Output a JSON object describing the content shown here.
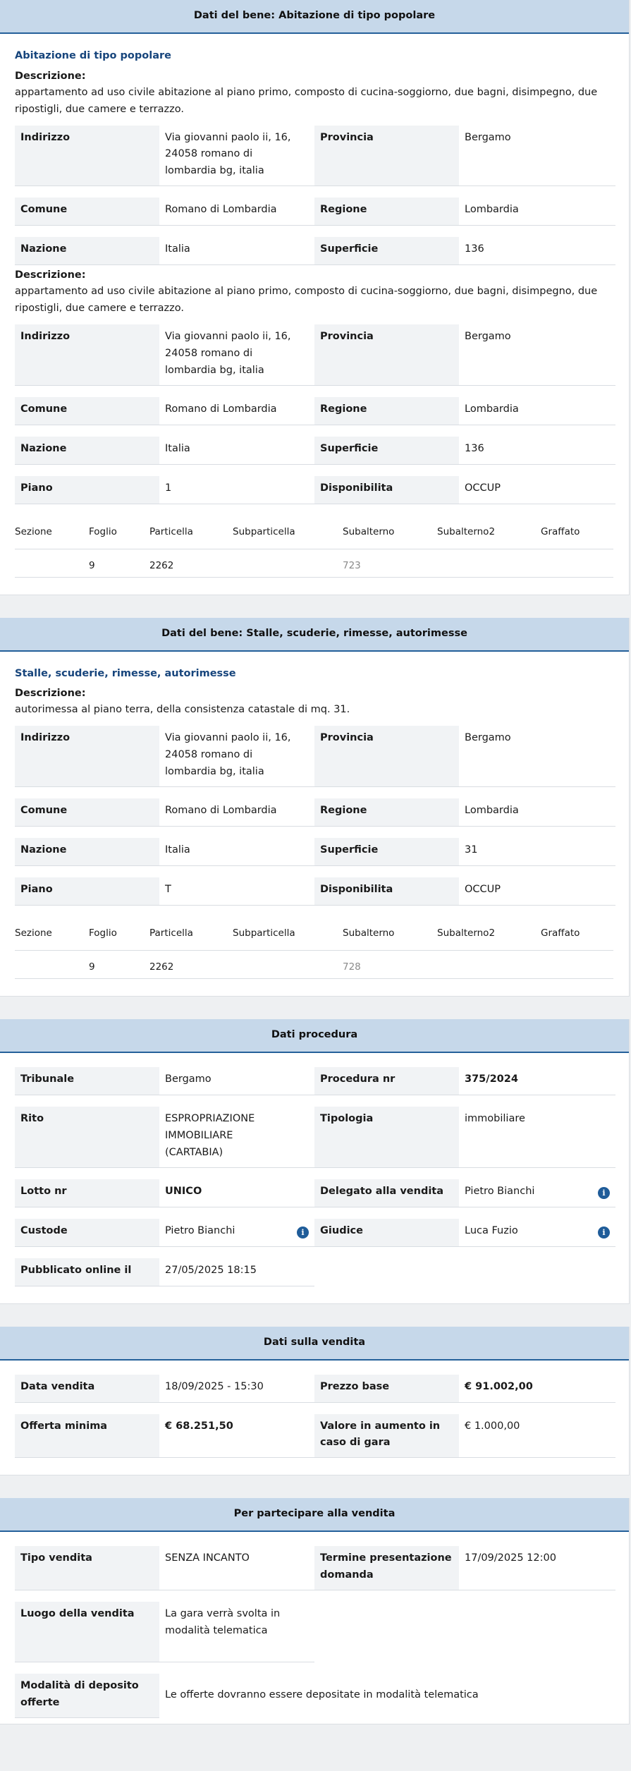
{
  "bene1": {
    "header": "Dati del bene: Abitazione di tipo popolare",
    "title": "Abitazione di tipo popolare",
    "desc_label": "Descrizione:",
    "description": "appartamento ad uso civile abitazione al piano primo, composto di cucina-soggiorno, due bagni, disimpegno, due ripostigli, due camere e terrazzo.",
    "rows_a": [
      {
        "k1": "Indirizzo",
        "v1": "Via giovanni paolo ii, 16, 24058 romano di lombardia bg, italia",
        "k2": "Provincia",
        "v2": "Bergamo"
      },
      {
        "k1": "Comune",
        "v1": "Romano di Lombardia",
        "k2": "Regione",
        "v2": "Lombardia"
      },
      {
        "k1": "Nazione",
        "v1": "Italia",
        "k2": "Superficie",
        "v2": "136"
      }
    ],
    "desc_label_2": "Descrizione:",
    "description_2": "appartamento ad uso civile abitazione al piano primo, composto di cucina-soggiorno, due bagni, disimpegno, due ripostigli, due camere e terrazzo.",
    "rows_b": [
      {
        "k1": "Indirizzo",
        "v1": "Via giovanni paolo ii, 16, 24058 romano di lombardia bg, italia",
        "k2": "Provincia",
        "v2": "Bergamo"
      },
      {
        "k1": "Comune",
        "v1": "Romano di Lombardia",
        "k2": "Regione",
        "v2": "Lombardia"
      },
      {
        "k1": "Nazione",
        "v1": "Italia",
        "k2": "Superficie",
        "v2": "136"
      },
      {
        "k1": "Piano",
        "v1": "1",
        "k2": "Disponibilita",
        "v2": "OCCUP"
      }
    ],
    "cadastre": {
      "headers": [
        "Sezione",
        "Foglio",
        "Particella",
        "Subparticella",
        "Subalterno",
        "Subalterno2",
        "Graffato"
      ],
      "values": [
        "",
        "9",
        "2262",
        "",
        "723",
        "",
        ""
      ]
    }
  },
  "bene2": {
    "header": "Dati del bene: Stalle, scuderie, rimesse, autorimesse",
    "title": "Stalle, scuderie, rimesse, autorimesse",
    "desc_label": "Descrizione:",
    "description": "autorimessa al piano terra, della consistenza catastale di mq. 31.",
    "rows": [
      {
        "k1": "Indirizzo",
        "v1": "Via giovanni paolo ii, 16, 24058 romano di lombardia bg, italia",
        "k2": "Provincia",
        "v2": "Bergamo"
      },
      {
        "k1": "Comune",
        "v1": "Romano di Lombardia",
        "k2": "Regione",
        "v2": "Lombardia"
      },
      {
        "k1": "Nazione",
        "v1": "Italia",
        "k2": "Superficie",
        "v2": "31"
      },
      {
        "k1": "Piano",
        "v1": "T",
        "k2": "Disponibilita",
        "v2": "OCCUP"
      }
    ],
    "cadastre": {
      "headers": [
        "Sezione",
        "Foglio",
        "Particella",
        "Subparticella",
        "Subalterno",
        "Subalterno2",
        "Graffato"
      ],
      "values": [
        "",
        "9",
        "2262",
        "",
        "728",
        "",
        ""
      ]
    }
  },
  "procedura": {
    "header": "Dati procedura",
    "tribunale_k": "Tribunale",
    "tribunale_v": "Bergamo",
    "procedura_k": "Procedura nr",
    "procedura_v": "375/2024",
    "rito_k": "Rito",
    "rito_v": "ESPROPRIAZIONE IMMOBILIARE (CARTABIA)",
    "tipologia_k": "Tipologia",
    "tipologia_v": "immobiliare",
    "lotto_k": "Lotto nr",
    "lotto_v": "UNICO",
    "delegato_k": "Delegato alla vendita",
    "delegato_v": "Pietro Bianchi",
    "custode_k": "Custode",
    "custode_v": "Pietro Bianchi",
    "giudice_k": "Giudice",
    "giudice_v": "Luca Fuzio",
    "pubblicato_k": "Pubblicato online il",
    "pubblicato_v": "27/05/2025 18:15",
    "info_glyph": "i"
  },
  "vendita": {
    "header": "Dati sulla vendita",
    "data_k": "Data vendita",
    "data_v": "18/09/2025 - 15:30",
    "prezzo_k": "Prezzo base",
    "prezzo_v": "€ 91.002,00",
    "offerta_k": "Offerta minima",
    "offerta_v": "€ 68.251,50",
    "aumento_k": "Valore in aumento in caso di gara",
    "aumento_v": "€ 1.000,00"
  },
  "partecipare": {
    "header": "Per partecipare alla vendita",
    "tipo_k": "Tipo vendita",
    "tipo_v": "SENZA INCANTO",
    "termine_k": "Termine presentazione domanda",
    "termine_v": "17/09/2025 12:00",
    "luogo_k": "Luogo della vendita",
    "luogo_v": "La gara verrà svolta in modalità telematica",
    "deposito_k": "Modalità di deposito offerte",
    "deposito_v": "Le offerte dovranno essere depositate in modalità telematica"
  },
  "colors": {
    "header_bg": "#c6d8ea",
    "header_border": "#24609a",
    "title": "#17457c",
    "key_bg": "#f1f3f5",
    "info": "#1f5c99"
  }
}
